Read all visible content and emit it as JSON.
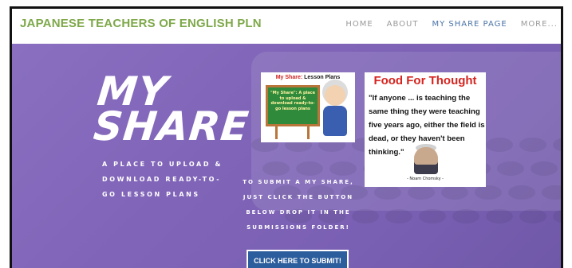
{
  "header": {
    "site_title": "JAPANESE TEACHERS OF ENGLISH PLN",
    "nav": [
      {
        "label": "HOME"
      },
      {
        "label": "ABOUT"
      },
      {
        "label": "MY SHARE PAGE"
      },
      {
        "label": "MORE..."
      }
    ],
    "active_nav": "MY SHARE PAGE",
    "title_color": "#7ea84a",
    "active_color": "#4a73a8"
  },
  "hero": {
    "title_line1": "MY",
    "title_line2": "SHARE",
    "subtitle": "A PLACE TO UPLOAD & DOWNLOAD READY-TO-GO LESSON PLANS",
    "submit_instructions": "TO SUBMIT A MY SHARE, JUST CLICK THE BUTTON BELOW DROP IT IN THE SUBMISSIONS FOLDER!",
    "submit_button": "CLICK HERE TO SUBMIT!",
    "background_color": "#8064b8",
    "button_color": "#2c5d9c"
  },
  "card_lesson_plans": {
    "title_prefix": "My Share:",
    "title_suffix": " Lesson Plans",
    "board_text": "\"My Share\": A place to upload & download ready-to-go lesson plans"
  },
  "card_quote": {
    "title": "Food For Thought",
    "quote": "\"If anyone ... is teaching the same thing they were teaching five years ago, either the field is dead, or they haven't been thinking.\"",
    "attribution": "- Noam Chomsky -"
  }
}
